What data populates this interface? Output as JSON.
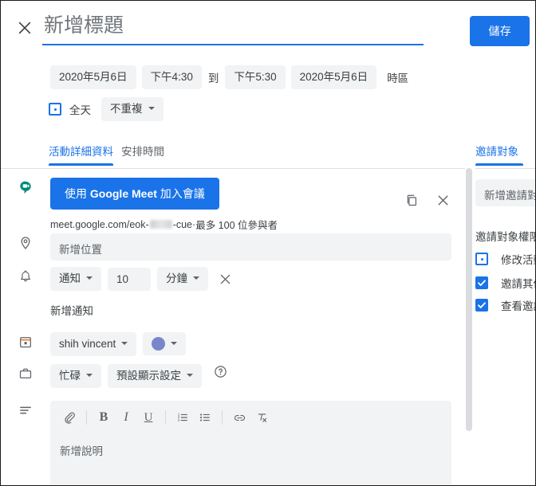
{
  "header": {
    "close_icon": "close-icon",
    "title_placeholder": "新增標題",
    "title_value": "",
    "save_label": "儲存"
  },
  "datetime": {
    "start_date": "2020年5月6日",
    "start_time": "下午4:30",
    "to_label": "到",
    "end_time": "下午5:30",
    "end_date": "2020年5月6日",
    "timezone_label": "時區",
    "allday_label": "全天",
    "allday_checked": false,
    "repeat_label": "不重複"
  },
  "tabs": [
    {
      "label": "活動詳細資料",
      "active": true
    },
    {
      "label": "安排時間",
      "active": false
    }
  ],
  "conference": {
    "icon": "google-meet-icon",
    "join_label_prefix": "使用 ",
    "join_label_brand": "Google Meet",
    "join_label_suffix": " 加入會議",
    "url_prefix": "meet.google.com/eok-",
    "url_suffix": "-cue",
    "url_separator": " · ",
    "capacity": "最多 100 位參與者",
    "copy_icon": "copy-icon",
    "remove_icon": "close-icon"
  },
  "location": {
    "icon": "location-pin-icon",
    "placeholder": "新增位置"
  },
  "notification": {
    "icon": "bell-icon",
    "type_label": "通知",
    "amount": "10",
    "unit_label": "分鐘",
    "remove_icon": "close-icon",
    "add_label": "新增通知"
  },
  "calendar": {
    "icon": "calendar-icon",
    "owner": "shih vincent",
    "color_hex": "#7986cb",
    "color_icon": "color-dot-icon"
  },
  "availability": {
    "icon": "briefcase-icon",
    "busy_label": "忙碌",
    "visibility_label": "預設顯示設定",
    "help_icon": "help-circle-icon"
  },
  "description": {
    "icon": "description-lines-icon",
    "placeholder": "新增說明",
    "toolbar": [
      {
        "name": "attach-icon",
        "label": ""
      },
      {
        "name": "bold-icon",
        "label": "B"
      },
      {
        "name": "italic-icon",
        "label": "I"
      },
      {
        "name": "underline-icon",
        "label": "U"
      },
      {
        "name": "numbered-list-icon",
        "label": ""
      },
      {
        "name": "bulleted-list-icon",
        "label": ""
      },
      {
        "name": "link-icon",
        "label": ""
      },
      {
        "name": "clear-formatting-icon",
        "label": ""
      }
    ]
  },
  "guests": {
    "tab_label": "邀請對象",
    "input_placeholder": "新增邀請對象",
    "permissions_title": "邀請對象權限",
    "permissions": [
      {
        "label": "修改活動",
        "checked": false
      },
      {
        "label": "邀請其他人",
        "checked": true
      },
      {
        "label": "查看邀請對象名單",
        "checked": true
      }
    ]
  },
  "theme": {
    "accent": "#1a73e8",
    "chip_bg": "#f1f3f4",
    "text": "#3c4043",
    "muted": "#5f6368",
    "meet_green": "#00897b"
  }
}
